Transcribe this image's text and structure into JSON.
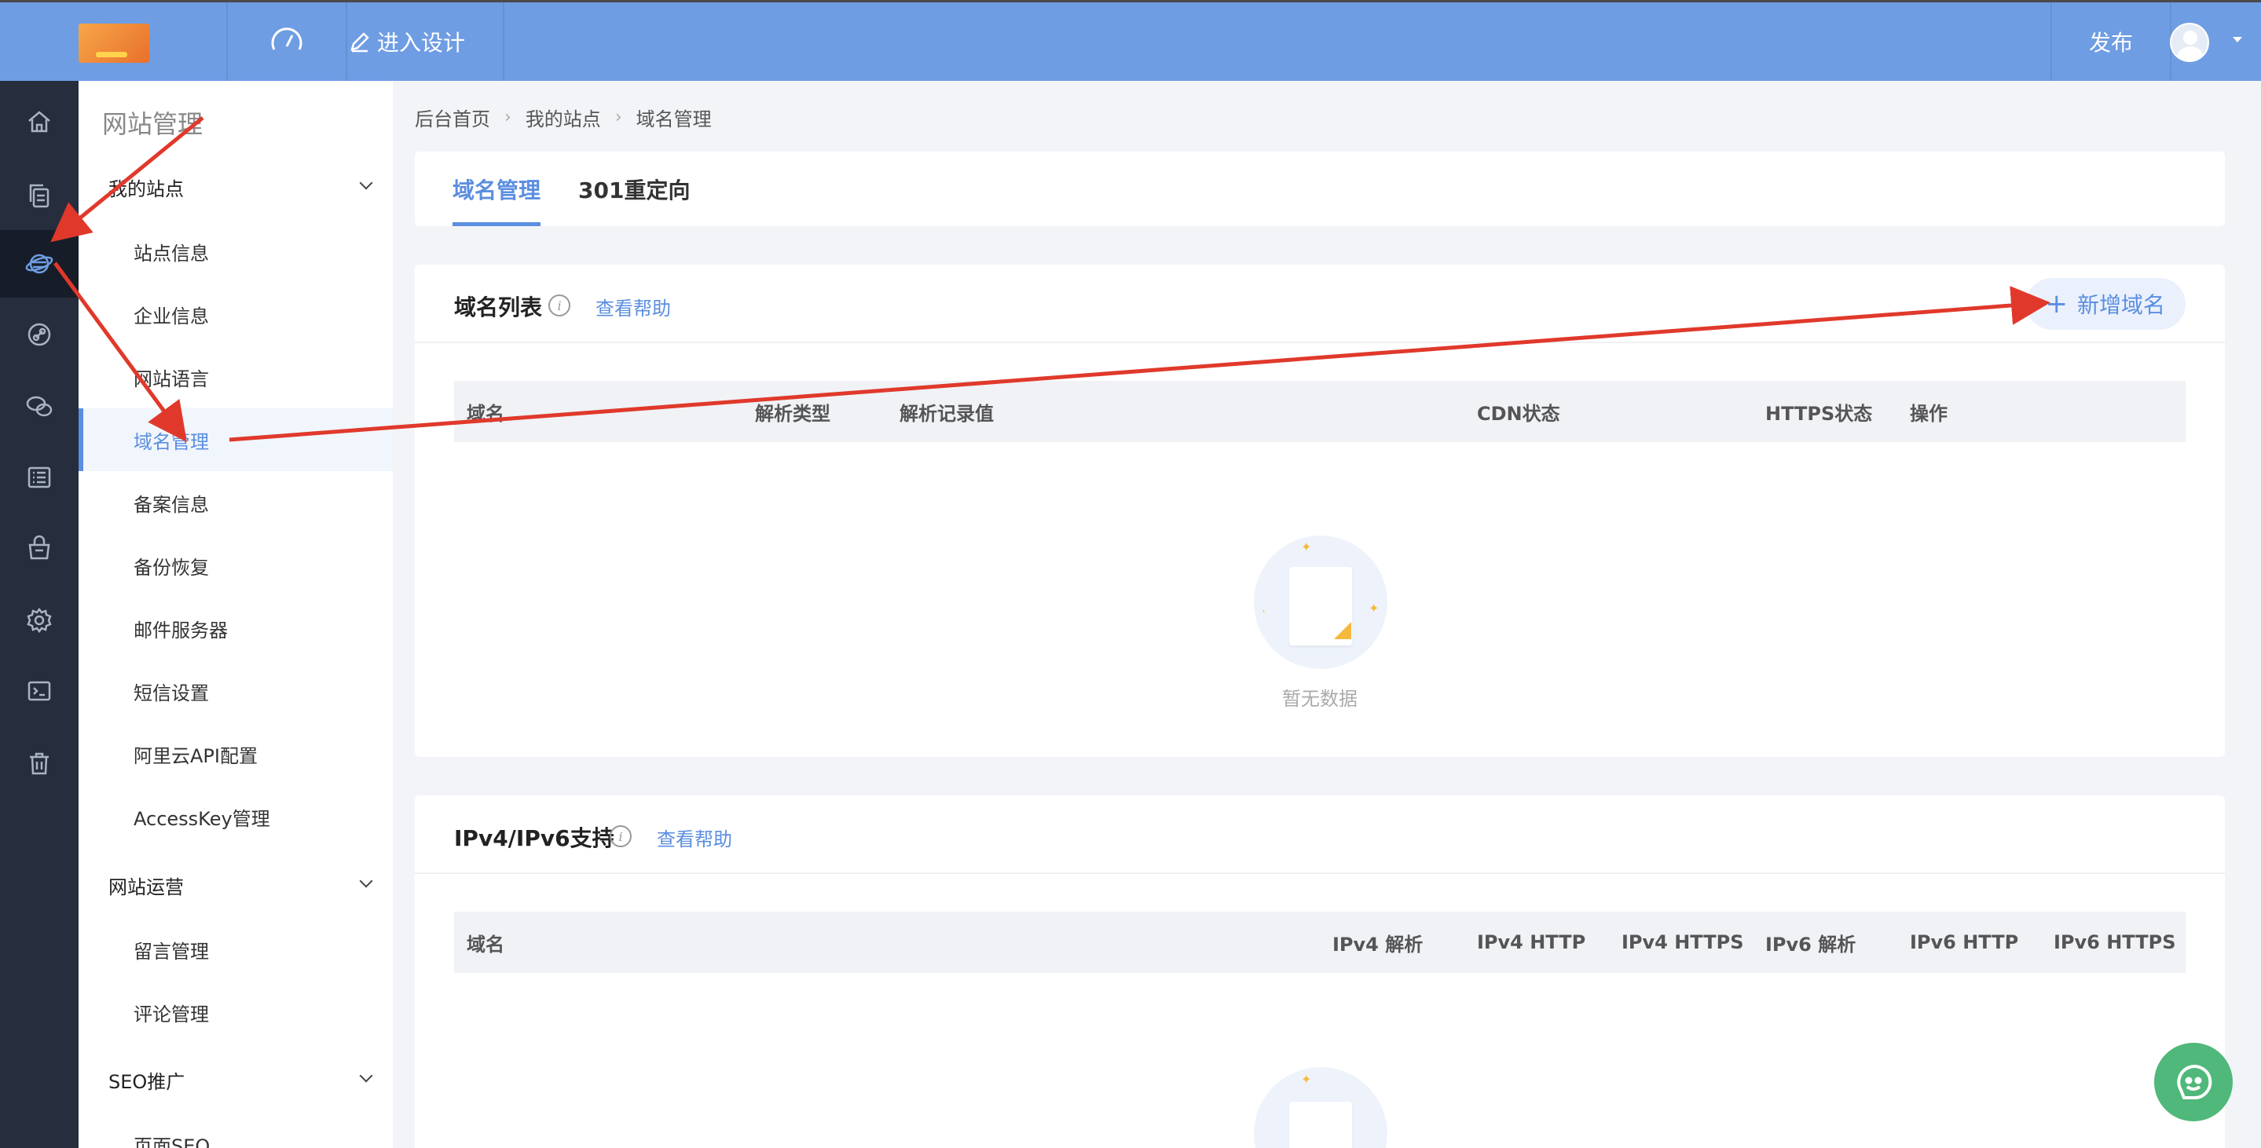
{
  "topbar": {
    "enter_design": "进入设计",
    "publish": "发布"
  },
  "sidebar": {
    "title": "网站管理",
    "groups": [
      {
        "label": "我的站点",
        "items": [
          "站点信息",
          "企业信息",
          "网站语言",
          "域名管理",
          "备案信息",
          "备份恢复",
          "邮件服务器",
          "短信设置",
          "阿里云API配置",
          "AccessKey管理"
        ]
      },
      {
        "label": "网站运营",
        "items": [
          "留言管理",
          "评论管理"
        ]
      },
      {
        "label": "SEO推广",
        "items": [
          "页面SEO"
        ]
      }
    ],
    "active_item": "域名管理"
  },
  "breadcrumb": [
    "后台首页",
    "我的站点",
    "域名管理"
  ],
  "tabs": [
    "域名管理",
    "301重定向"
  ],
  "domain_list": {
    "title": "域名列表",
    "help": "查看帮助",
    "add_button": "新增域名",
    "columns": [
      "域名",
      "解析类型",
      "解析记录值",
      "CDN状态",
      "HTTPS状态",
      "操作"
    ],
    "empty_text": "暂无数据"
  },
  "ipv": {
    "title": "IPv4/IPv6支持",
    "help": "查看帮助",
    "columns": [
      "域名",
      "IPv4 解析",
      "IPv4 HTTP",
      "IPv4 HTTPS",
      "IPv6 解析",
      "IPv6 HTTP",
      "IPv6 HTTPS"
    ]
  },
  "icons": {
    "rail": [
      "home-icon",
      "pages-icon",
      "globe-icon",
      "link-icon",
      "wechat-icon",
      "list-icon",
      "store-icon",
      "gear-icon",
      "terminal-icon",
      "trash-icon"
    ]
  },
  "colors": {
    "topbar": "#6f9de3",
    "rail": "#262e3d",
    "accent": "#5b8ee0",
    "annotation_arrow": "#e0392b",
    "chat": "#4fb87a"
  }
}
